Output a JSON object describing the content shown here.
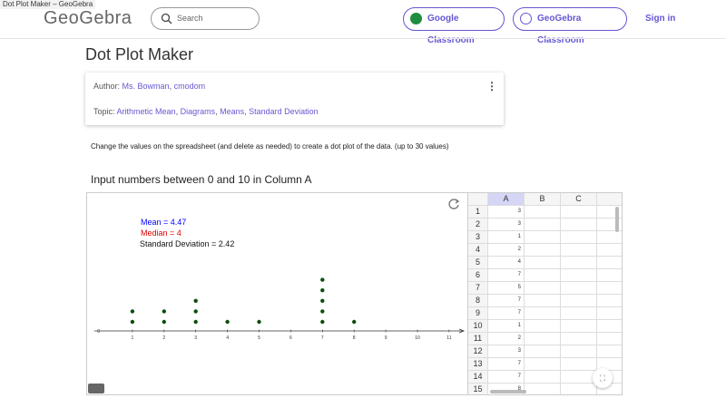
{
  "browser": {
    "tab_title": "Dot Plot Maker – GeoGebra"
  },
  "header": {
    "logo": "GeoGebra",
    "search_placeholder": "Search",
    "google_classroom": "Google Classroom",
    "geogebra_classroom": "GeoGebra Classroom",
    "sign_in": "Sign in"
  },
  "page": {
    "title": "Dot Plot Maker",
    "author_label": "Author:",
    "authors": [
      "Ms. Bowman",
      "cmodom"
    ],
    "topic_label": "Topic:",
    "topics": [
      "Arithmetic Mean",
      "Diagrams",
      "Means",
      "Standard Deviation"
    ],
    "description": "Change the values on the spreadsheet (and delete as needed) to create a dot plot of the data. (up to 30 values)",
    "subtitle": "Input numbers between 0 and 10 in Column A"
  },
  "stats": {
    "mean": "Mean = 4.47",
    "median": "Median = 4",
    "sd": "Standard Deviation = 2.42"
  },
  "colors": {
    "mean": "#0000ff",
    "median": "#dd0000",
    "dot": "#0b4d0b",
    "accent": "#6557d2"
  },
  "spreadsheet": {
    "columns": [
      "A",
      "B",
      "C"
    ],
    "rows": [
      "1",
      "2",
      "3",
      "4",
      "5",
      "6",
      "7",
      "8",
      "9",
      "10",
      "11",
      "12",
      "13",
      "14",
      "15"
    ],
    "values_a": [
      "3",
      "3",
      "1",
      "2",
      "4",
      "7",
      "5",
      "7",
      "7",
      "1",
      "2",
      "3",
      "7",
      "7",
      "8"
    ]
  },
  "chart_data": {
    "type": "scatter",
    "title": "Dot plot",
    "x_ticks": [
      "0",
      "1",
      "2",
      "3",
      "4",
      "5",
      "6",
      "7",
      "8",
      "9",
      "10",
      "11"
    ],
    "xlim": [
      0,
      11
    ],
    "values": [
      3,
      3,
      1,
      2,
      4,
      7,
      5,
      7,
      7,
      1,
      2,
      3,
      7,
      7,
      8
    ]
  }
}
